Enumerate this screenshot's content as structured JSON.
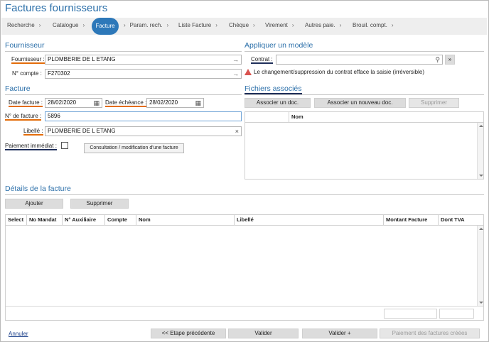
{
  "page": {
    "title": "Factures fournisseurs"
  },
  "steps": [
    {
      "label": "Recherche",
      "active": false
    },
    {
      "label": "Catalogue",
      "active": false
    },
    {
      "label": "Facture",
      "active": true
    },
    {
      "label": "Param. rech.",
      "active": false
    },
    {
      "label": "Liste Facture",
      "active": false
    },
    {
      "label": "Chèque",
      "active": false
    },
    {
      "label": "Virement",
      "active": false
    },
    {
      "label": "Autres paie.",
      "active": false
    },
    {
      "label": "Brouil. compt.",
      "active": false
    }
  ],
  "fournisseur": {
    "section": "Fournisseur",
    "label": "Fournisseur :",
    "value": "PLOMBERIE DE L ETANG",
    "compte_label": "N° compte :",
    "compte_value": "F270302"
  },
  "modele": {
    "section": "Appliquer un modèle",
    "contrat_label": "Contrat :",
    "contrat_value": "",
    "add_button": "»",
    "warning": "Le changement/suppression du contrat efface la saisie (irréversible)"
  },
  "facture": {
    "section": "Facture",
    "date_label": "Date facture :",
    "date_value": "28/02/2020",
    "echeance_label": "Date échéance :",
    "echeance_value": "28/02/2020",
    "numero_label": "N° de facture :",
    "numero_value": "5896",
    "libelle_label": "Libellé :",
    "libelle_value": "PLOMBERIE DE L ETANG",
    "paiement_label": "Paiement immédiat :",
    "consult_button": "Consultation / modification d'une facture"
  },
  "fichiers": {
    "section": "Fichiers associés",
    "associer_button": "Associer un doc.",
    "associer_nouveau_button": "Associer un nouveau doc.",
    "supprimer_button": "Supprimer",
    "col_nom": "Nom"
  },
  "details": {
    "section": "Détails de la facture",
    "ajouter_button": "Ajouter",
    "supprimer_button": "Supprimer",
    "columns": [
      "Select",
      "No Mandat",
      "N° Auxiliaire",
      "Compte",
      "Nom",
      "Libellé",
      "Montant Facture",
      "Dont TVA"
    ]
  },
  "footer": {
    "annuler": "Annuler",
    "precedente": "<< Etape précédente",
    "valider": "Valider",
    "valider_plus": "Valider +",
    "paiement": "Paiement des factures créées"
  },
  "colors": {
    "accent": "#2d78b9",
    "orange_underline": "#e36c0a",
    "navy_underline": "#1f2f5a",
    "warning": "#d9534f"
  }
}
